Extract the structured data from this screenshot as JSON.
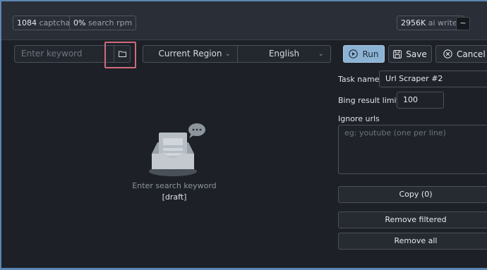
{
  "topbar": {
    "captcha_count": "1084",
    "captcha_label": "captcha",
    "search_rpm_value": "0%",
    "search_rpm_label": "search rpm",
    "ai_writer_count": "2956K",
    "ai_writer_label": "ai writer",
    "menu_label": "~"
  },
  "toolbar": {
    "keyword_placeholder": "Enter keyword",
    "region_value": "Current Region",
    "language_value": "English",
    "run_label": "Run",
    "save_label": "Save",
    "cancel_label": "Cancel"
  },
  "empty_state": {
    "message": "Enter search keyword",
    "status": "[draft]"
  },
  "form": {
    "task_name_label": "Task name:",
    "task_name_value": "Url Scraper #2",
    "bing_limit_label": "Bing result limit:",
    "bing_limit_value": "100",
    "ignore_urls_label": "Ignore urls",
    "ignore_urls_placeholder": "eg: youtube (one per line)"
  },
  "actions": {
    "copy_label": "Copy (0)",
    "remove_filtered_label": "Remove filtered",
    "remove_all_label": "Remove all"
  },
  "colors": {
    "highlight": "#d06b7d",
    "run_button": "#8db3d4"
  }
}
